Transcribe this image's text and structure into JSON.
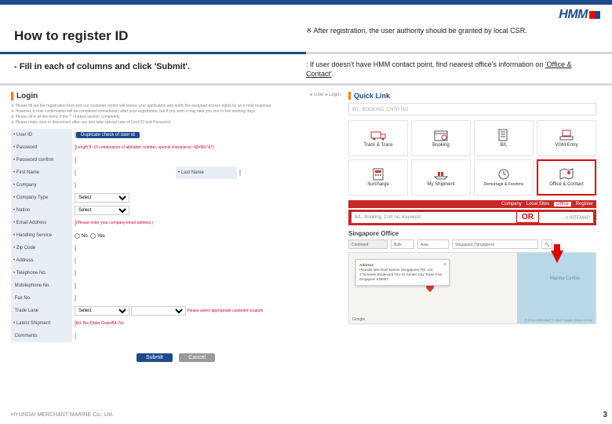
{
  "logo": "HMM",
  "title": "How to register ID",
  "note1": "※ After registration, the user authority should be granted by local CSR.",
  "instruction": "- Fill in each of columns and click 'Submit'.",
  "note2_a": ": If user doesn't have HMM contact point, find nearest office's information on ",
  "note2_link": "'Office & Contact'",
  "note2_b": ".",
  "login": {
    "heading": "Login",
    "crumb": "▸ User ▸ Login",
    "info1": "※ Please fill out the registration form and our customer center will review your application and notify the assigned access rights by an e-mail response.",
    "info2": "※ However, e-mail confirmation will be completed immediately after your registration, but if you wish it may take you one to two working days.",
    "info3": "※ Please fill in all the items if the '*' marked section completely.",
    "info4": "※ Please make sure to disconnect after use and take special care of User ID and Password.",
    "fields": {
      "user_id": "User ID",
      "password": "Password",
      "password_confirm": "Password confirm",
      "first_name": "First Name",
      "last_name": "Last Name",
      "company": "Company",
      "company_type": "Company Type",
      "nation": "Nation",
      "email": "Email Address",
      "handling_service": "Handling Service",
      "zip": "Zip Code",
      "address": "Address",
      "telephone": "Telephone No.",
      "mobile": "Mobilephone No.",
      "fax": "Fax No.",
      "trade_lane": "Trade Lane",
      "latest_shipment": "Latest Shipment",
      "comments": "Comments"
    },
    "dup_btn": "Duplicate check of user id",
    "pw_hint": "Length 8~15 combination of alphabet, number, special characters(~!@#$%^&*)",
    "select_placeholder": "Select",
    "email_hint": "(Please enter your company email address.)",
    "svc_no": "No",
    "svc_yes": "Yes",
    "trade_hint": "Please select appropriate customer location.",
    "shipment_hint": "B/L No./Order Code/B/L No.",
    "submit": "Submit",
    "cancel": "Cancel"
  },
  "quicklink": {
    "heading": "Quick Link",
    "search_placeholder": "B/L, BOOKING, CNTR NO",
    "items": [
      "Track & Trace",
      "Booking",
      "B/L",
      "VGM Entry",
      "Surcharge",
      "My Shipment",
      "Demurrage & Freetime",
      "Office & Contact"
    ]
  },
  "or_label": "OR",
  "redbar": {
    "items": [
      "Company",
      "Local Sites",
      "Office",
      "Register"
    ],
    "active_index": 2
  },
  "redsearch_placeholder": "B/L, Booking, Cntr no, Keyword",
  "office": {
    "heading": "Singapore Office",
    "tabs": [
      "Continent",
      "Bulk"
    ],
    "sel1": "Asia",
    "sel2": "Singapore (Singapore)",
    "addr_title": "Address",
    "addr_body": "Hyundai Merchant Marine (Singapore) Pte. Ltd.\n3 Temasek Boulevard #41-01 Suntec City Tower Five Singapore 038987",
    "marina": "Marina Centre",
    "google": "Google",
    "terms": "© 2016 HMM MAP © 2016 Google Terms of Use"
  },
  "footer": "HYUNDAI MERCHANT MARINE Co., Ltd.",
  "pagenum": "3"
}
